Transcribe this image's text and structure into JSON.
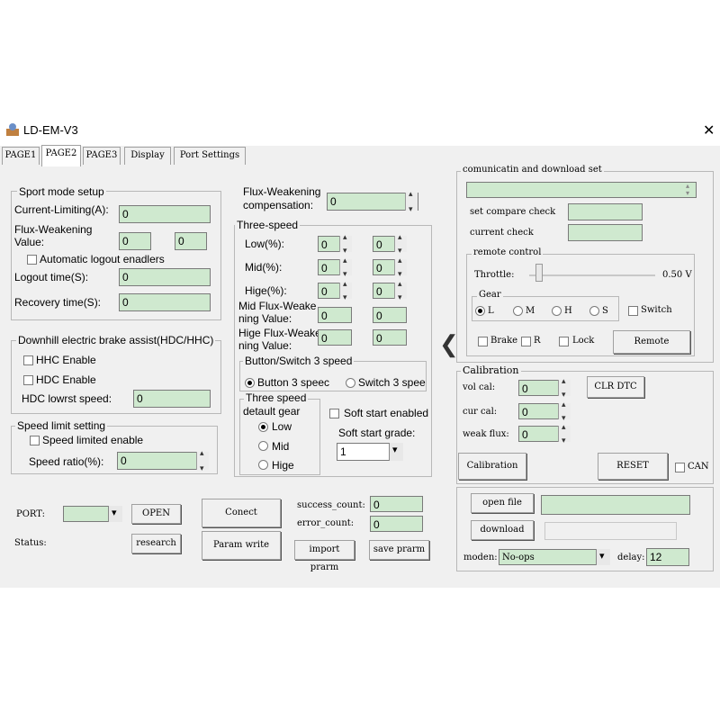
{
  "app": {
    "title": "LD-EM-V3",
    "close_glyph": "✕"
  },
  "tabs": [
    {
      "label": "PAGE1",
      "active": false
    },
    {
      "label": "PAGE2",
      "active": true
    },
    {
      "label": "PAGE3",
      "active": false
    },
    {
      "label": "Display",
      "active": false
    },
    {
      "label": "Port Settings",
      "active": false
    }
  ],
  "sport": {
    "legend": "Sport mode setup",
    "current_label": "Current-Limiting(A):",
    "current_value": "0",
    "flux_label1": "Flux-Weakening",
    "flux_label2": "Value:",
    "flux_value1": "0",
    "flux_value2": "0",
    "auto_logout_label": "Automatic logout enadlers",
    "logout_label": "Logout time(S):",
    "logout_value": "0",
    "recovery_label": "Recovery time(S):",
    "recovery_value": "0"
  },
  "downhill": {
    "legend": "Downhill electric brake assist(HDC/HHC)",
    "hhc_label": "HHC Enable",
    "hdc_label": "HDC Enable",
    "speed_label": "HDC lowrst speed:",
    "speed_value": "0"
  },
  "speed_limit": {
    "legend": "Speed limit setting",
    "enable_label": "Speed limited enable",
    "ratio_label": "Speed ratio(%):",
    "ratio_value": "0"
  },
  "flux_comp": {
    "label1": "Flux-Weakening",
    "label2": "compensation:",
    "value": "0"
  },
  "three_speed": {
    "legend": "Three-speed",
    "rows": [
      {
        "label": "Low(%):",
        "v1": "0",
        "v2": "0"
      },
      {
        "label": "Mid(%):",
        "v1": "0",
        "v2": "0"
      },
      {
        "label": "Hige(%):",
        "v1": "0",
        "v2": "0"
      }
    ],
    "mid_flux_label1": "Mid Flux-Weake",
    "mid_flux_label2": "ning Value:",
    "mid_flux_v1": "0",
    "mid_flux_v2": "0",
    "hige_flux_label1": "Hige Flux-Weake",
    "hige_flux_label2": "ning Value:",
    "hige_flux_v1": "0",
    "hige_flux_v2": "0"
  },
  "button_switch": {
    "legend": "Button/Switch 3 speed",
    "opt1": "Button 3 speec",
    "opt2": "Switch 3 spee"
  },
  "default_gear": {
    "legend1": "Three speed",
    "legend2": "detault gear",
    "low": "Low",
    "mid": "Mid",
    "hige": "Hige"
  },
  "soft_start": {
    "enabled_label": "Soft start enabled",
    "grade_label": "Soft start grade:",
    "grade_value": "1"
  },
  "port": {
    "port_label": "PORT:",
    "open_label": "OPEN",
    "status_label": "Status:",
    "research_label": "research",
    "connect_label": "Conect",
    "param_write_label": "Param write",
    "success_label": "success_count:",
    "success_value": "0",
    "error_label": "error_count:",
    "error_value": "0",
    "import_label": "import prarm",
    "save_label": "save prarm"
  },
  "comm": {
    "legend": "comunicatin and download set",
    "set_compare_label": "set compare check",
    "current_check_label": "current check"
  },
  "remote": {
    "legend": "remote control",
    "throttle_label": "Throttle:",
    "throttle_value": "0.50 V",
    "throttle_level": 0.05,
    "gear_legend": "Gear",
    "gears": [
      "L",
      "M",
      "H",
      "S"
    ],
    "switch_label": "Switch",
    "brake_label": "Brake",
    "r_label": "R",
    "lock_label": "Lock",
    "remote_button": "Remote"
  },
  "collapse_glyph": "❮",
  "calibration": {
    "legend": "Calibration",
    "vol_label": "vol cal:",
    "vol_value": "0",
    "cur_label": "cur cal:",
    "cur_value": "0",
    "weak_label": "weak flux:",
    "weak_value": "0",
    "clr_dtc": "CLR DTC",
    "calibration_button": "Calibration",
    "reset_button": "RESET",
    "can_label": "CAN"
  },
  "download": {
    "open_file": "open file",
    "download": "download",
    "moden_label": "moden:",
    "moden_value": "No-ops",
    "delay_label": "delay:",
    "delay_value": "12"
  }
}
